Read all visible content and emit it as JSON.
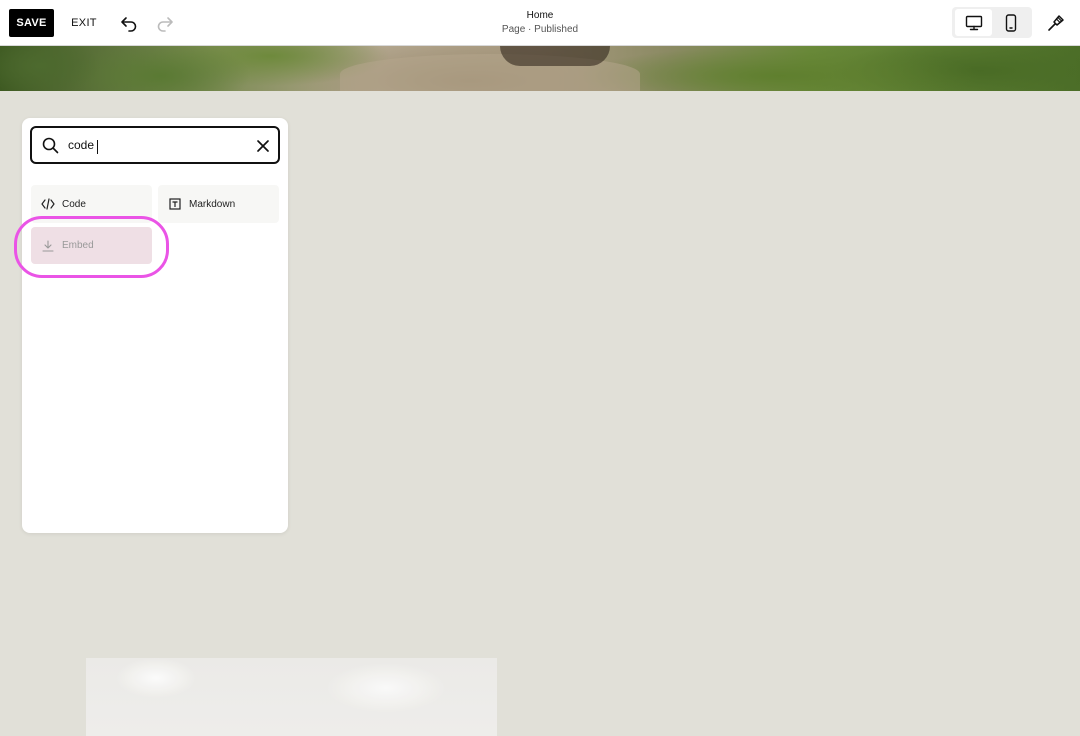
{
  "toolbar": {
    "save_label": "SAVE",
    "exit_label": "EXIT",
    "page_title": "Home",
    "page_status": "Page · Published"
  },
  "search": {
    "value": "code",
    "placeholder": ""
  },
  "blocks": [
    {
      "label": "Code",
      "icon": "code-brackets-icon"
    },
    {
      "label": "Markdown",
      "icon": "markdown-icon"
    },
    {
      "label": "Embed",
      "icon": "download-icon",
      "highlighted": true
    }
  ],
  "colors": {
    "canvas": "#e1e0d8",
    "save_button": "#000000",
    "highlight_ring": "#ea54e6",
    "embed_hover": "#efdfe5"
  }
}
